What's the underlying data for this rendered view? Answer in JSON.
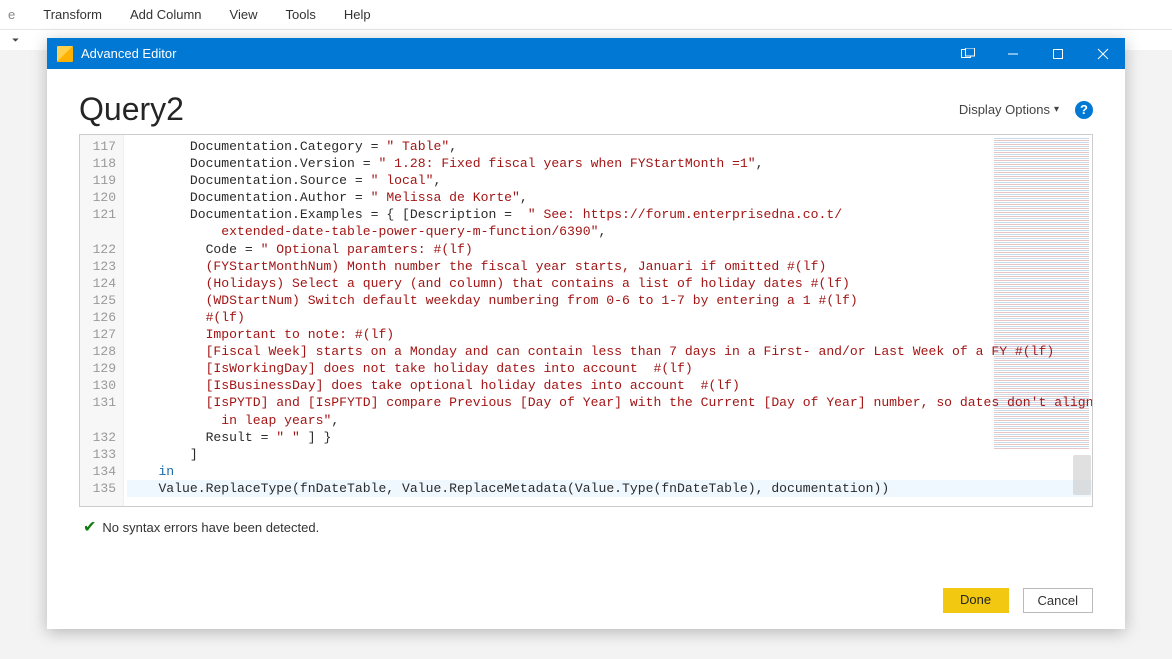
{
  "ribbon": {
    "items": [
      "Transform",
      "Add Column",
      "View",
      "Tools",
      "Help"
    ],
    "truncated_left": "e"
  },
  "dialog": {
    "title": "Advanced Editor",
    "query_name": "Query2",
    "display_options_label": "Display Options",
    "status_text": "No syntax errors have been detected.",
    "done_label": "Done",
    "cancel_label": "Cancel"
  },
  "line_numbers": [
    117,
    118,
    119,
    120,
    121,
    122,
    123,
    124,
    125,
    126,
    127,
    128,
    129,
    130,
    131,
    132,
    133,
    134,
    135
  ],
  "code_lines": [
    {
      "indent": "        ",
      "tokens": [
        [
          "g1",
          "Documentation.Category = "
        ],
        [
          "g2",
          "\" Table\""
        ],
        [
          "g1",
          ","
        ]
      ]
    },
    {
      "indent": "        ",
      "tokens": [
        [
          "g1",
          "Documentation.Version = "
        ],
        [
          "g2",
          "\" 1.28: Fixed fiscal years when FYStartMonth =1\""
        ],
        [
          "g1",
          ","
        ]
      ]
    },
    {
      "indent": "        ",
      "tokens": [
        [
          "g1",
          "Documentation.Source = "
        ],
        [
          "g2",
          "\" local\""
        ],
        [
          "g1",
          ","
        ]
      ]
    },
    {
      "indent": "        ",
      "tokens": [
        [
          "g1",
          "Documentation.Author = "
        ],
        [
          "g2",
          "\" Melissa de Korte\""
        ],
        [
          "g1",
          ","
        ]
      ]
    },
    {
      "indent": "        ",
      "tokens": [
        [
          "g1",
          "Documentation.Examples = { [Description =  "
        ],
        [
          "g2",
          "\" See: https://forum.enterprisedna.co.t/"
        ]
      ]
    },
    {
      "indent": "            ",
      "tokens": [
        [
          "g2",
          "extended-date-table-power-query-m-function/6390\""
        ],
        [
          "g1",
          ","
        ]
      ]
    },
    {
      "indent": "          ",
      "tokens": [
        [
          "g1",
          "Code = "
        ],
        [
          "g2",
          "\" Optional paramters: #(lf)"
        ]
      ]
    },
    {
      "indent": "          ",
      "tokens": [
        [
          "g2",
          "(FYStartMonthNum) Month number the fiscal year starts, Januari if omitted #(lf)"
        ]
      ]
    },
    {
      "indent": "          ",
      "tokens": [
        [
          "g2",
          "(Holidays) Select a query (and column) that contains a list of holiday dates #(lf)"
        ]
      ]
    },
    {
      "indent": "          ",
      "tokens": [
        [
          "g2",
          "(WDStartNum) Switch default weekday numbering from 0-6 to 1-7 by entering a 1 #(lf)"
        ]
      ]
    },
    {
      "indent": "          ",
      "tokens": [
        [
          "g2",
          "#(lf)"
        ]
      ]
    },
    {
      "indent": "          ",
      "tokens": [
        [
          "g2",
          "Important to note: #(lf)"
        ]
      ]
    },
    {
      "indent": "          ",
      "tokens": [
        [
          "g2",
          "[Fiscal Week] starts on a Monday and can contain less than 7 days in a First- and/or Last Week of a FY #(lf)"
        ]
      ]
    },
    {
      "indent": "          ",
      "tokens": [
        [
          "g2",
          "[IsWorkingDay] does not take holiday dates into account  #(lf)"
        ]
      ]
    },
    {
      "indent": "          ",
      "tokens": [
        [
          "g2",
          "[IsBusinessDay] does take optional holiday dates into account  #(lf)"
        ]
      ]
    },
    {
      "indent": "          ",
      "tokens": [
        [
          "g2",
          "[IsPYTD] and [IsPFYTD] compare Previous [Day of Year] with the Current [Day of Year] number, so dates don't align"
        ]
      ]
    },
    {
      "indent": "            ",
      "tokens": [
        [
          "g2",
          "in leap years\""
        ],
        [
          "g1",
          ","
        ]
      ]
    },
    {
      "indent": "          ",
      "tokens": [
        [
          "g1",
          "Result = "
        ],
        [
          "g2",
          "\" \""
        ],
        [
          "g1",
          " ] }"
        ]
      ]
    },
    {
      "indent": "        ",
      "tokens": [
        [
          "g1",
          "]"
        ]
      ]
    },
    {
      "indent": "    ",
      "tokens": [
        [
          "g4",
          "in"
        ]
      ]
    },
    {
      "indent": "    ",
      "tokens": [
        [
          "g1",
          "Value.ReplaceType(fnDateTable, Value.ReplaceMetadata(Value.Type(fnDateTable), documentation))"
        ]
      ],
      "highlight": true
    }
  ]
}
